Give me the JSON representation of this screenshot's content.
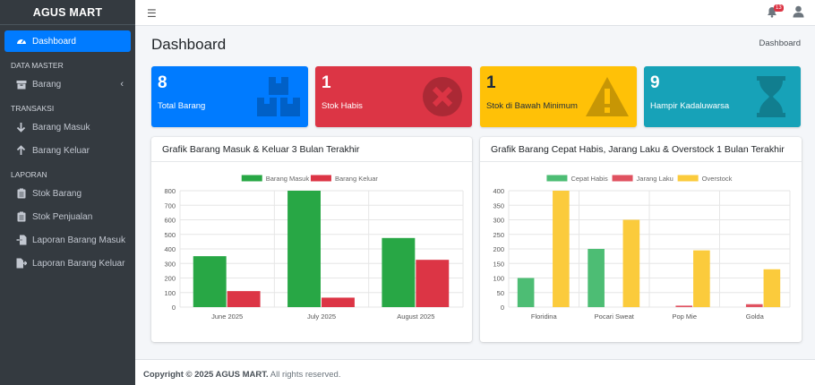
{
  "brand": "AGUS MART",
  "sidebar": {
    "dashboard": "Dashboard",
    "section_master": "DATA MASTER",
    "barang": "Barang",
    "section_transaksi": "TRANSAKSI",
    "barang_masuk": "Barang Masuk",
    "barang_keluar": "Barang Keluar",
    "section_laporan": "LAPORAN",
    "stok_barang": "Stok Barang",
    "stok_penjualan": "Stok Penjualan",
    "laporan_masuk": "Laporan Barang Masuk",
    "laporan_keluar": "Laporan Barang Keluar"
  },
  "topbar": {
    "notif_count": "13"
  },
  "page": {
    "title": "Dashboard",
    "breadcrumb": "Dashboard"
  },
  "stats": [
    {
      "value": "8",
      "label": "Total Barang",
      "color": "#007bff",
      "icon": "boxes-icon"
    },
    {
      "value": "1",
      "label": "Stok Habis",
      "color": "#dc3545",
      "icon": "times-circle-icon"
    },
    {
      "value": "1",
      "label": "Stok di Bawah Minimum",
      "color": "#ffc107",
      "icon": "warning-icon"
    },
    {
      "value": "9",
      "label": "Hampir Kadaluwarsa",
      "color": "#17a2b8",
      "icon": "hourglass-icon"
    }
  ],
  "chart1_title": "Grafik Barang Masuk & Keluar 3 Bulan Terakhir",
  "chart2_title": "Grafik Barang Cepat Habis, Jarang Laku & Overstock 1 Bulan Terakhir",
  "chart_data": [
    {
      "type": "bar",
      "categories": [
        "June 2025",
        "July 2025",
        "August 2025"
      ],
      "series": [
        {
          "name": "Barang Masuk",
          "values": [
            350,
            800,
            475
          ],
          "color": "#28a745"
        },
        {
          "name": "Barang Keluar",
          "values": [
            110,
            65,
            325
          ],
          "color": "#dc3545"
        }
      ],
      "ylim": [
        0,
        800
      ],
      "yticks": [
        0,
        100,
        200,
        300,
        400,
        500,
        600,
        700,
        800
      ],
      "legend": "top"
    },
    {
      "type": "bar",
      "categories": [
        "Floridina",
        "Pocari Sweat",
        "Pop Mie",
        "Golda"
      ],
      "series": [
        {
          "name": "Cepat Habis",
          "values": [
            100,
            200,
            0,
            0
          ],
          "color": "#4dbd74"
        },
        {
          "name": "Jarang Laku",
          "values": [
            0,
            0,
            5,
            10
          ],
          "color": "#e05260"
        },
        {
          "name": "Overstock",
          "values": [
            400,
            300,
            195,
            130
          ],
          "color": "#fbcb3c"
        }
      ],
      "ylim": [
        0,
        400
      ],
      "yticks": [
        0,
        50,
        100,
        150,
        200,
        250,
        300,
        350,
        400
      ],
      "legend": "top"
    }
  ],
  "footer": {
    "copyright": "Copyright © 2025 AGUS MART.",
    "rights": " All rights reserved."
  }
}
